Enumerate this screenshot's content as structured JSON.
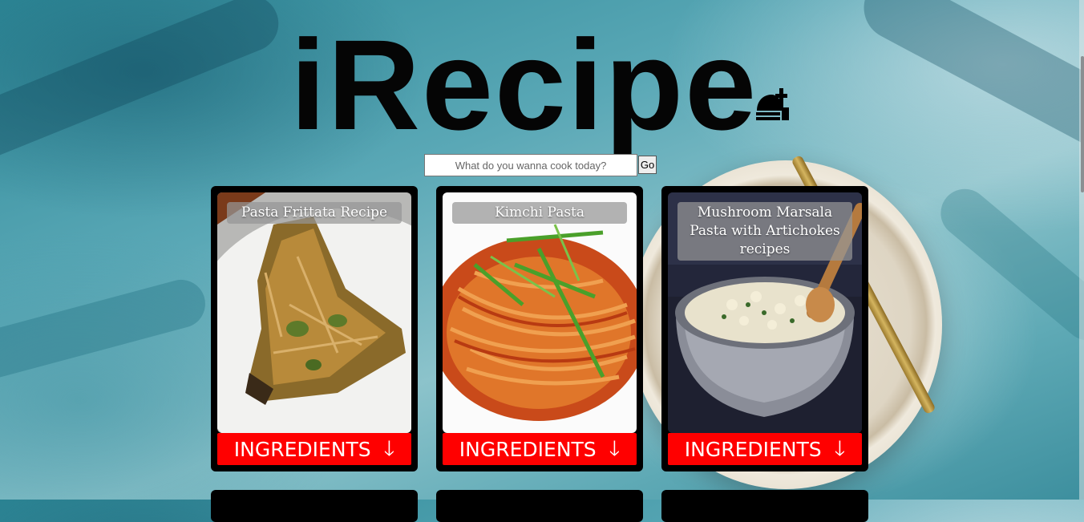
{
  "brand": {
    "title": "iRecipe",
    "icon": "chef-hat-fork-icon"
  },
  "search": {
    "placeholder": "What do you wanna cook today?",
    "value": "",
    "button_label": "Go"
  },
  "cards": [
    {
      "title": "Pasta Frittata Recipe",
      "button_label": "INGREDIENTS",
      "button_icon": "arrow-down-icon"
    },
    {
      "title": "Kimchi Pasta",
      "button_label": "INGREDIENTS",
      "button_icon": "arrow-down-icon"
    },
    {
      "title": "Mushroom Marsala Pasta with Artichokes recipes",
      "button_label": "INGREDIENTS",
      "button_icon": "arrow-down-icon"
    }
  ],
  "colors": {
    "accent": "#ff0000",
    "card_bg": "#000000",
    "title_overlay": "#969696"
  }
}
